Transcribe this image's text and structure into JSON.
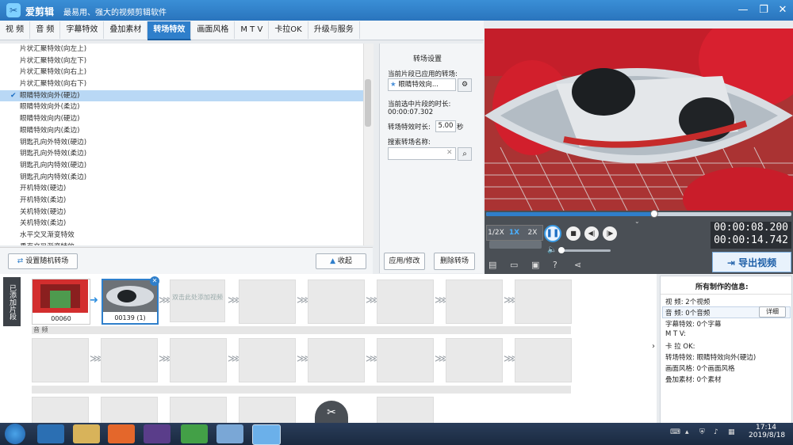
{
  "app": {
    "title": "爱剪辑",
    "slogan": "最易用、强大的视频剪辑软件",
    "window_buttons": [
      "—",
      "❐",
      "✕"
    ]
  },
  "tabs": [
    "视 频",
    "音 频",
    "字幕特效",
    "叠加素材",
    "转场特效",
    "画面风格",
    "M T V",
    "卡拉OK",
    "升级与服务"
  ],
  "active_tab": "转场特效",
  "effects": [
    "片状汇聚特效(向左上)",
    "片状汇聚特效(向左下)",
    "片状汇聚特效(向右上)",
    "片状汇聚特效(向右下)",
    "眼睛特效向外(硬边)",
    "眼睛特效向外(柔边)",
    "眼睛特效向内(硬边)",
    "眼睛特效向内(柔边)",
    "钥匙孔向外特效(硬边)",
    "钥匙孔向外特效(柔边)",
    "钥匙孔向内特效(硬边)",
    "钥匙孔向内特效(柔边)",
    "开机特效(硬边)",
    "开机特效(柔边)",
    "关机特效(硬边)",
    "关机特效(柔边)",
    "水平交叉渐变特效",
    "垂直交叉渐变特效"
  ],
  "selected_effect_index": 4,
  "left_buttons": {
    "random": "设置随机转场",
    "collapse": "收起"
  },
  "settings": {
    "heading": "转场设置",
    "applied_label": "当前片段已应用的转场:",
    "applied_value": "眼睛特效向...",
    "duration_label": "当前选中片段的时长:",
    "duration_value": "00:00:07.302",
    "effect_duration_label": "转场特效时长:",
    "effect_duration_value": "5.00",
    "effect_duration_unit": "秒",
    "search_label": "搜索转场名称:",
    "search_value": "",
    "apply_button": "应用/修改",
    "delete_button": "删除转场"
  },
  "player": {
    "speeds": [
      "1/2X",
      "1X",
      "2X"
    ],
    "active_speed": "1X",
    "current_time": "00:00:08.200",
    "total_time": "00:00:14.742",
    "progress": 0.55,
    "volume": 0.0,
    "export_label": "导出视频"
  },
  "timeline": {
    "side_label": "已添加片段",
    "clips": [
      {
        "name": "00060"
      },
      {
        "name": "00139 (1)"
      }
    ],
    "add_hint": "双击此处添加视频",
    "audio_label": "音 频"
  },
  "info": {
    "heading": "所有制作的信息:",
    "rows": [
      {
        "k": "视    频:",
        "v": "2个视频"
      },
      {
        "k": "音    频:",
        "v": "0个音频"
      },
      {
        "k": "字幕特效:",
        "v": "0个字幕"
      },
      {
        "k": "M  T  V:",
        "v": ""
      },
      {
        "k": "卡 拉 OK:",
        "v": ""
      },
      {
        "k": "转场特效:",
        "v": "眼睛特效向外(硬边)"
      },
      {
        "k": "画面风格:",
        "v": "0个画面风格"
      },
      {
        "k": "叠加素材:",
        "v": "0个素材"
      }
    ],
    "detail_button": "详细"
  },
  "taskbar": {
    "time": "17:14",
    "date": "2019/8/18"
  }
}
